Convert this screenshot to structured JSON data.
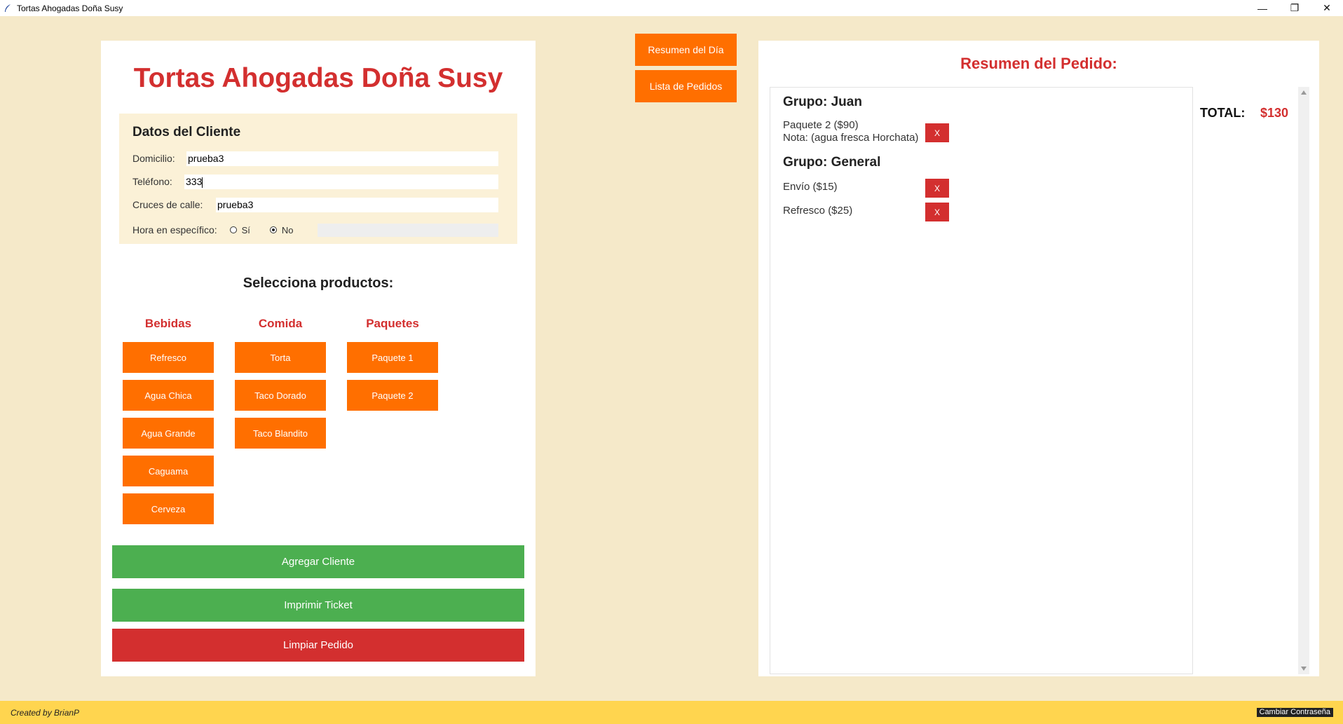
{
  "window": {
    "title": "Tortas Ahogadas Doña Susy",
    "minimize": "—",
    "restore": "❐",
    "close": "✕"
  },
  "app_title": "Tortas Ahogadas Doña Susy",
  "cliente": {
    "heading": "Datos del Cliente",
    "domicilio_label": "Domicilio:",
    "domicilio_value": "prueba3",
    "telefono_label": "Teléfono:",
    "telefono_value": "333",
    "cruces_label": "Cruces de calle:",
    "cruces_value": "prueba3",
    "hora_label": "Hora en específico:",
    "hora_si": "Sí",
    "hora_no": "No",
    "hora_selected": "No"
  },
  "productos": {
    "heading": "Selecciona productos:",
    "categorias": [
      {
        "title": "Bebidas",
        "items": [
          "Refresco",
          "Agua Chica",
          "Agua Grande",
          "Caguama",
          "Cerveza"
        ]
      },
      {
        "title": "Comida",
        "items": [
          "Torta",
          "Taco Dorado",
          "Taco Blandito"
        ]
      },
      {
        "title": "Paquetes",
        "items": [
          "Paquete 1",
          "Paquete 2"
        ]
      }
    ]
  },
  "actions": {
    "agregar": "Agregar Cliente",
    "imprimir": "Imprimir Ticket",
    "limpiar": "Limpiar Pedido"
  },
  "top_buttons": {
    "resumen_dia": "Resumen del Día",
    "lista_pedidos": "Lista de Pedidos"
  },
  "resumen": {
    "title": "Resumen del Pedido:",
    "grupos": [
      {
        "name": "Grupo: Juan",
        "items": [
          {
            "line1": "Paquete 2 ($90)",
            "line2": "Nota: (agua fresca Horchata)"
          }
        ]
      },
      {
        "name": "Grupo: General",
        "items": [
          {
            "line1": "Envío ($15)"
          },
          {
            "line1": "Refresco ($25)"
          }
        ]
      }
    ],
    "remove_label": "X",
    "total_label": "TOTAL:",
    "total_value": "$130"
  },
  "footer": {
    "credit": "Created by BrianP",
    "cambiar_pwd": "Cambiar Contraseña"
  },
  "colors": {
    "background": "#f5e9c9",
    "accent_orange": "#ff6f00",
    "accent_red": "#d32f2f",
    "accent_green": "#4caf50",
    "footer": "#ffd54f"
  }
}
